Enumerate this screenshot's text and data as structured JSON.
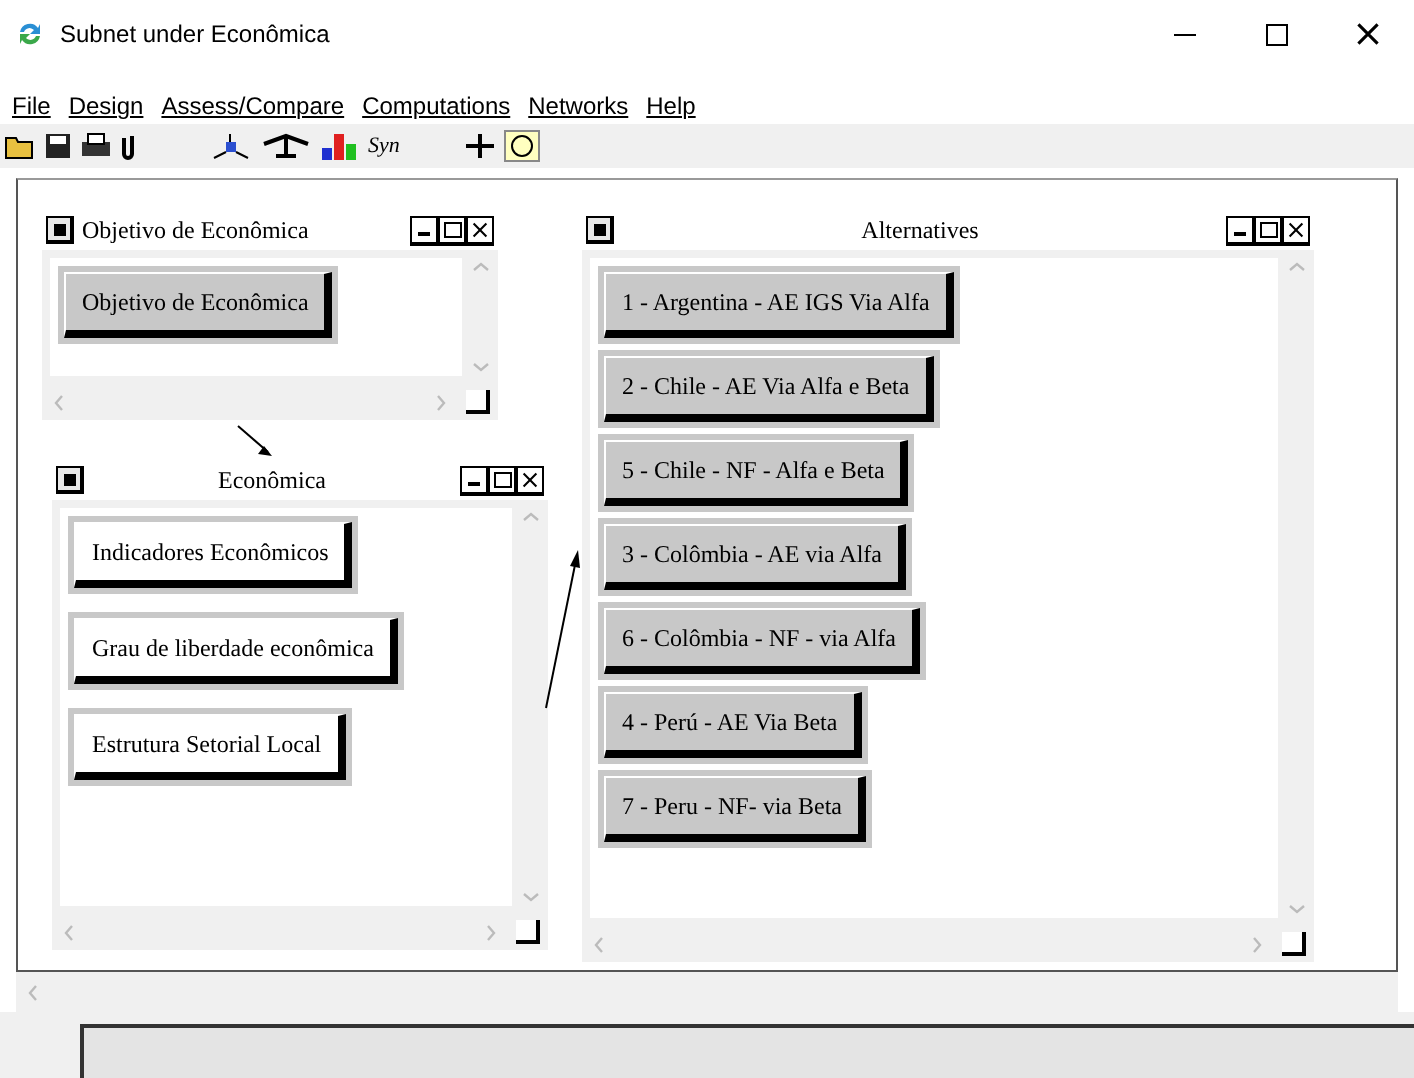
{
  "window": {
    "title": "Subnet under Econômica"
  },
  "menu": [
    "File",
    "Design",
    "Assess/Compare",
    "Computations",
    "Networks",
    "Help"
  ],
  "toolbar": {
    "syn_label": "Syn"
  },
  "panels": [
    {
      "title": "Objetivo de Econômica",
      "nodes": [
        "Objetivo de Econômica"
      ]
    },
    {
      "title": "Econômica",
      "nodes": [
        "Indicadores Econômicos",
        "Grau de liberdade econômica",
        "Estrutura Setorial Local"
      ]
    },
    {
      "title": "Alternatives",
      "nodes": [
        "1 - Argentina - AE IGS Via Alfa",
        "2 - Chile - AE Via Alfa e Beta",
        "5 - Chile - NF - Alfa e Beta",
        "3 - Colômbia - AE via Alfa",
        "6 - Colômbia - NF - via Alfa",
        "4 - Perú - AE Via Beta",
        "7 - Peru - NF- via Beta"
      ]
    }
  ]
}
